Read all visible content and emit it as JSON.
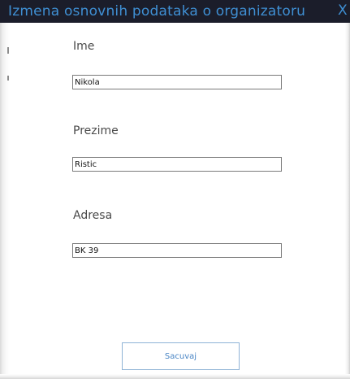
{
  "window": {
    "title": "Izmena osnovnih podataka o organizatoru",
    "close_glyph": "X",
    "title_bar_color": "#1b1d2a",
    "title_text_color": "#3f8fd3"
  },
  "form": {
    "first_name": {
      "label": "Ime",
      "value": "Nikola"
    },
    "last_name": {
      "label": "Prezime",
      "value": "Ristic"
    },
    "address": {
      "label": "Adresa",
      "value": "BK 39"
    }
  },
  "actions": {
    "save_label": "Sacuvaj",
    "save_accent_color": "#4a86c5"
  }
}
